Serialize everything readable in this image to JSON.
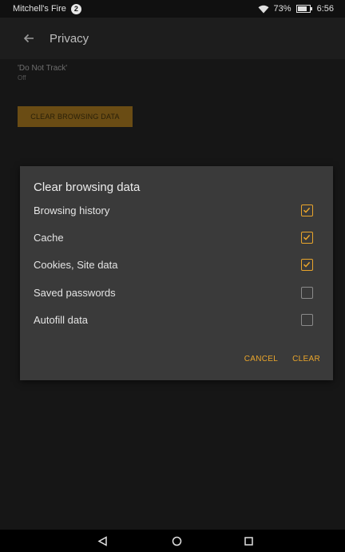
{
  "status_bar": {
    "device_name": "Mitchell's Fire",
    "notification_count": "2",
    "battery_percent": "73%",
    "time": "6:56"
  },
  "action_bar": {
    "title": "Privacy",
    "back_icon": "back-arrow-icon"
  },
  "background_page": {
    "do_not_track_title": "'Do Not Track'",
    "do_not_track_summary": "Off",
    "clear_button_label": "CLEAR BROWSING DATA"
  },
  "dialog": {
    "title": "Clear browsing data",
    "options": [
      {
        "label": "Browsing history",
        "checked": true
      },
      {
        "label": "Cache",
        "checked": true
      },
      {
        "label": "Cookies, Site data",
        "checked": true
      },
      {
        "label": "Saved passwords",
        "checked": false
      },
      {
        "label": "Autofill data",
        "checked": false
      }
    ],
    "cancel_label": "CANCEL",
    "clear_label": "CLEAR"
  },
  "nav_bar": {
    "back_icon": "nav-back-triangle-icon",
    "home_icon": "nav-home-circle-icon",
    "recents_icon": "nav-recents-square-icon"
  },
  "colors": {
    "accent": "#e9a52b",
    "dialog_background": "#3a3a3a",
    "screen_background": "#161616"
  }
}
